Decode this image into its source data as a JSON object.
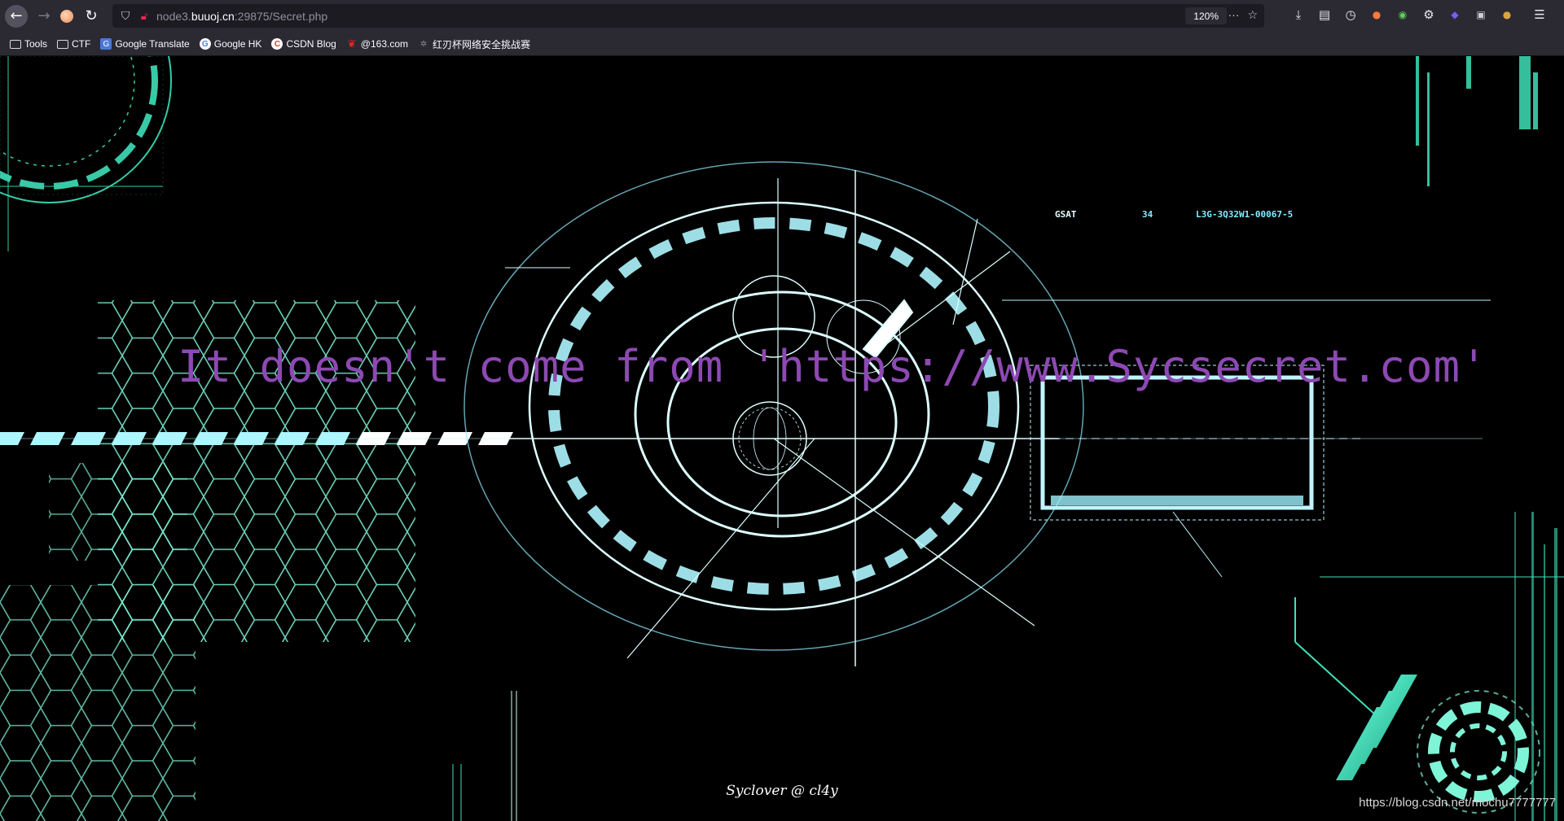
{
  "browser": {
    "url_prefix": "node3.",
    "url_host": "buuoj.cn",
    "url_suffix": ":29875/Secret.php",
    "zoom": "120%"
  },
  "bookmarks": [
    {
      "label": "Tools",
      "icon": "folder-icon"
    },
    {
      "label": "CTF",
      "icon": "folder-icon"
    },
    {
      "label": "Google Translate",
      "icon": "google-translate-icon"
    },
    {
      "label": "Google HK",
      "icon": "google-icon"
    },
    {
      "label": "CSDN Blog",
      "icon": "csdn-icon"
    },
    {
      "label": "@163.com",
      "icon": "163-icon"
    },
    {
      "label": "红刃杯网络安全挑战赛",
      "icon": "site-icon"
    }
  ],
  "page": {
    "message": "It doesn't come from 'https://www.Sycsecret.com'",
    "footer": "Syclover @ cl4y",
    "watermark": "https://blog.csdn.net/mochu7777777",
    "hud_label_gsat": "GSAT",
    "hud_label_num": "34",
    "hud_label_code": "L3G-3Q32W1-00067-5",
    "message_color": "#8d49b3",
    "accent_color": "#5fffd8"
  }
}
